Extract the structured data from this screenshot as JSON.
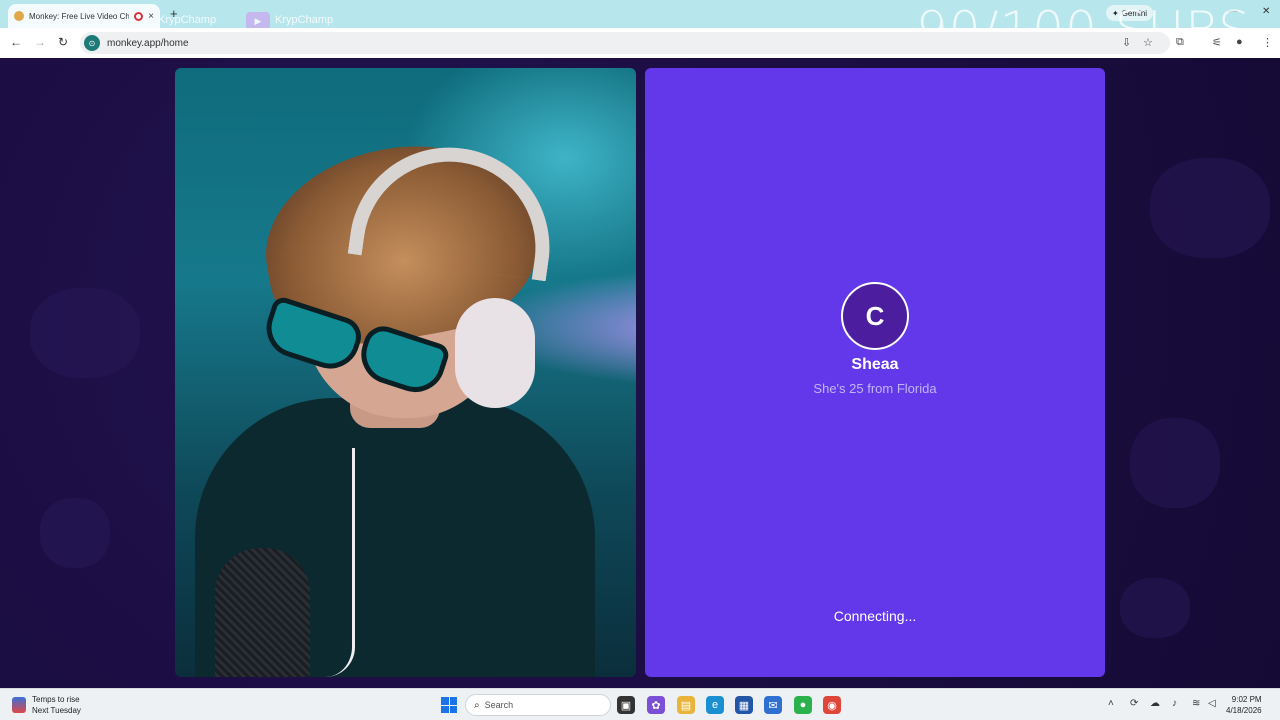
{
  "browser": {
    "tab_title": "Monkey: Free Live Video Chat",
    "tab_close": "×",
    "new_tab": "+",
    "url": "monkey.app/home",
    "gemini_label": "Gemini",
    "window_controls": [
      "—",
      "☐",
      "✕"
    ]
  },
  "stream_overlay": {
    "username_1": "KrypChamp",
    "username_2": "KrypChamp",
    "counter_text": "90/100 SUBS"
  },
  "match": {
    "avatar_initial": "C",
    "name": "Sheaa",
    "info": "She's 25 from Florida",
    "status": "Connecting..."
  },
  "taskbar": {
    "weather_line1": "Temps to rise",
    "weather_line2": "Next Tuesday",
    "search_placeholder": "Search",
    "time": "9:02 PM",
    "date": "4/18/2026"
  },
  "colors": {
    "page_bg": "#1c0f45",
    "match_panel": "#6338ea",
    "avatar_bg": "#4d1da0",
    "tabstrip": "#b7e6ec"
  }
}
